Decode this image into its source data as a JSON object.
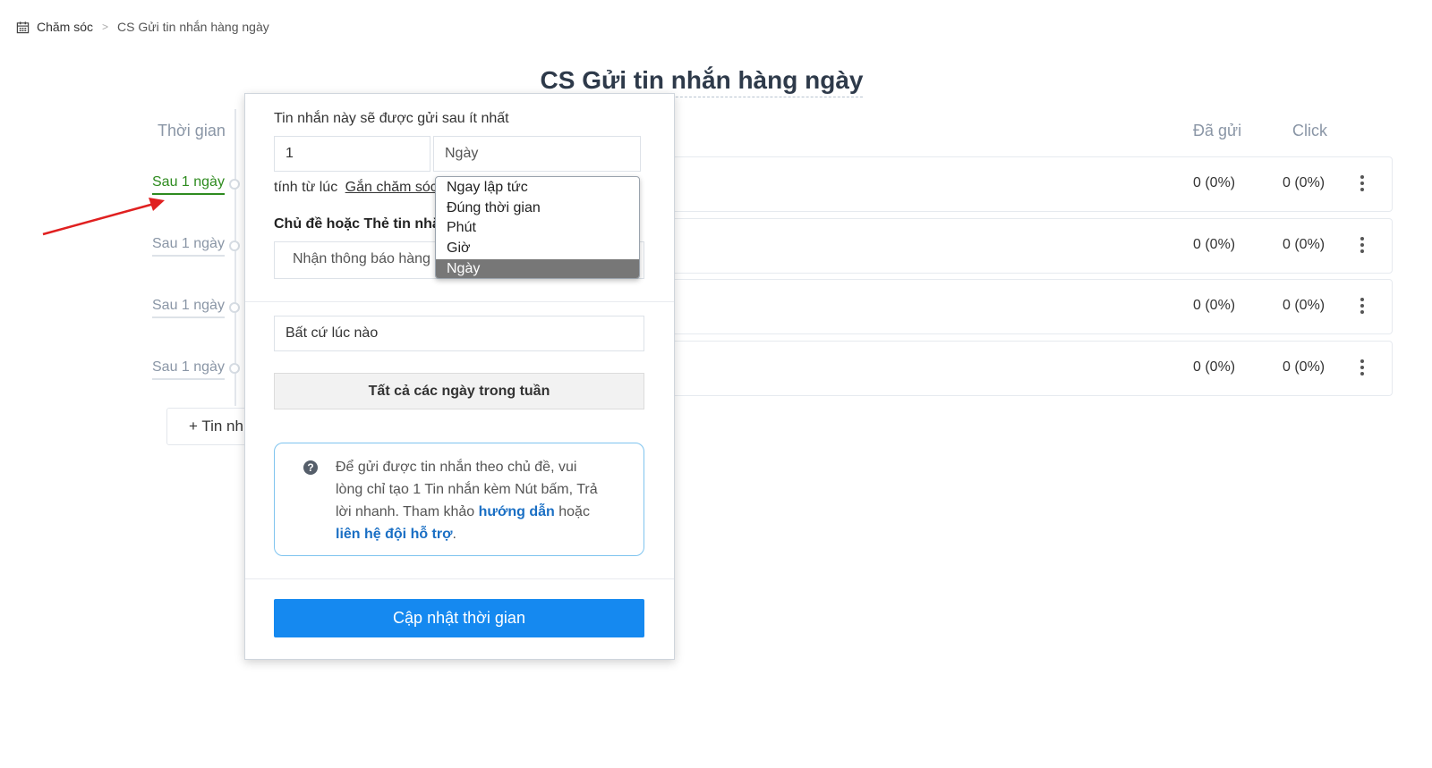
{
  "breadcrumb": {
    "root": "Chăm sóc",
    "separator": ">",
    "current": "CS Gửi tin nhắn hàng ngày"
  },
  "page_title": "CS Gửi tin nhắn hàng ngày",
  "columns": {
    "time": "Thời gian",
    "sent": "Đã gửi",
    "click": "Click"
  },
  "timeline": [
    {
      "label": "Sau 1 ngày",
      "active": true
    },
    {
      "label": "Sau 1 ngày",
      "active": false
    },
    {
      "label": "Sau 1 ngày",
      "active": false
    },
    {
      "label": "Sau 1 ngày",
      "active": false
    }
  ],
  "rows": [
    {
      "sent": "0 (0%)",
      "click": "0 (0%)"
    },
    {
      "sent": "0 (0%)",
      "click": "0 (0%)"
    },
    {
      "sent": "0 (0%)",
      "click": "0 (0%)"
    },
    {
      "sent": "0 (0%)",
      "click": "0 (0%)"
    }
  ],
  "add_button": "+ Tin nh",
  "popup": {
    "intro": "Tin nhắn này sẽ được gửi sau ít nhất",
    "amount_value": "1",
    "unit_value": "Ngày",
    "since_label": "tính từ lúc",
    "since_link": "Gắn chăm sóc",
    "topic_label": "Chủ đề hoặc Thẻ tin nhắ",
    "topic_value": "Nhận thông báo hàng",
    "anytime_value": "Bất cứ lúc nào",
    "days_button": "Tất cả các ngày trong tuần",
    "info": {
      "icon": "?",
      "text_1": "Để gửi được tin nhắn theo chủ đề, vui lòng chỉ tạo 1 Tin nhắn kèm Nút bấm, Trả lời nhanh. Tham khảo ",
      "link_1": "hướng dẫn",
      "text_2": " hoặc ",
      "link_2": "liên hệ đội hỗ trợ",
      "text_3": "."
    },
    "update_button": "Cập nhật thời gian"
  },
  "unit_dropdown": {
    "options": [
      "Ngay lập tức",
      "Đúng thời gian",
      "Phút",
      "Giờ",
      "Ngày"
    ],
    "selected": "Ngày"
  },
  "colors": {
    "accent_blue": "#1589f0",
    "active_green": "#2e8b1f",
    "arrow_red": "#e02020",
    "info_border": "#7fc4ef"
  }
}
